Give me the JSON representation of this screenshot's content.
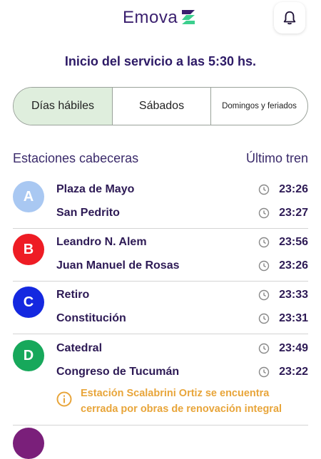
{
  "header": {
    "logo_text": "Emova",
    "notifications_icon": "bell-icon"
  },
  "service_title": "Inicio del servicio a las 5:30 hs.",
  "tabs": [
    {
      "label": "Días hábiles",
      "selected": true
    },
    {
      "label": "Sábados",
      "selected": false
    },
    {
      "label": "Domingos y feriados",
      "selected": false
    }
  ],
  "columns": {
    "left": "Estaciones cabeceras",
    "right": "Último tren"
  },
  "lines": [
    {
      "letter": "A",
      "color": "#a9c8f2",
      "stations": [
        {
          "name": "Plaza de Mayo",
          "time": "23:26"
        },
        {
          "name": "San Pedrito",
          "time": "23:27"
        }
      ]
    },
    {
      "letter": "B",
      "color": "#ee1c24",
      "stations": [
        {
          "name": "Leandro N. Alem",
          "time": "23:56"
        },
        {
          "name": "Juan Manuel de Rosas",
          "time": "23:26"
        }
      ]
    },
    {
      "letter": "C",
      "color": "#1428e0",
      "stations": [
        {
          "name": "Retiro",
          "time": "23:33"
        },
        {
          "name": "Constitución",
          "time": "23:31"
        }
      ]
    },
    {
      "letter": "D",
      "color": "#17a85b",
      "stations": [
        {
          "name": "Catedral",
          "time": "23:49"
        },
        {
          "name": "Congreso de Tucumán",
          "time": "23:22"
        }
      ],
      "notice": {
        "line1": "Estación Scalabrini Ortiz se encuentra",
        "line2": "cerrada por obras de renovación integral",
        "icon": "info-circle-icon",
        "color": "#e8a53a"
      }
    }
  ],
  "colors": {
    "accent": "#2d1a66",
    "selected_tab_bg": "#dfeedd",
    "logo_mark": "#3ccf8e"
  }
}
